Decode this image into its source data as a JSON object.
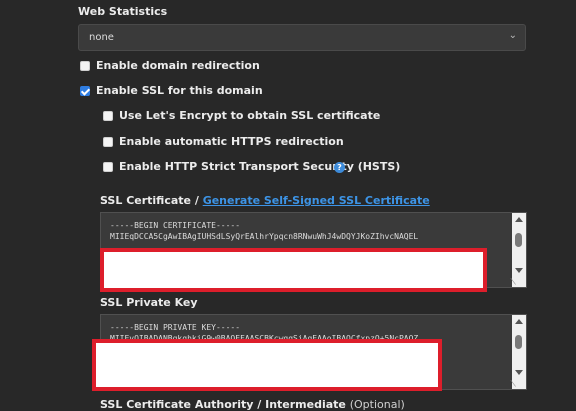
{
  "web_statistics": {
    "label": "Web Statistics",
    "value": "none"
  },
  "options": {
    "domain_redirection": "Enable domain redirection",
    "ssl": "Enable SSL for this domain",
    "lets_encrypt": "Use Let's Encrypt to obtain SSL certificate",
    "https_redirect": "Enable automatic HTTPS redirection",
    "hsts": "Enable HTTP Strict Transport Security (HSTS)"
  },
  "ssl_certificate": {
    "label": "SSL Certificate /",
    "link": "Generate Self-Signed SSL Certificate",
    "line1": "-----BEGIN CERTIFICATE-----",
    "line2": "MIIEqDCCA5CgAwIBAgIUHSdLSyQrEAlhrYpqcn8RNwuWhJ4wDQYJKoZIhvcNAQEL"
  },
  "ssl_private_key": {
    "label": "SSL Private Key",
    "line1": "-----BEGIN PRIVATE KEY-----",
    "line2": "MIIEvQIBADANBgkqhkiG9w0BAQEFAASCBKcwggSjAgEAAoIBAQCfxpzQ+5NcPAOZ"
  },
  "ssl_ca": {
    "label": "SSL Certificate Authority / Intermediate",
    "optional": "(Optional)"
  },
  "colors": {
    "accent": "#2f7de1",
    "link": "#3d94e6",
    "redaction_border": "#dd1e2b"
  }
}
